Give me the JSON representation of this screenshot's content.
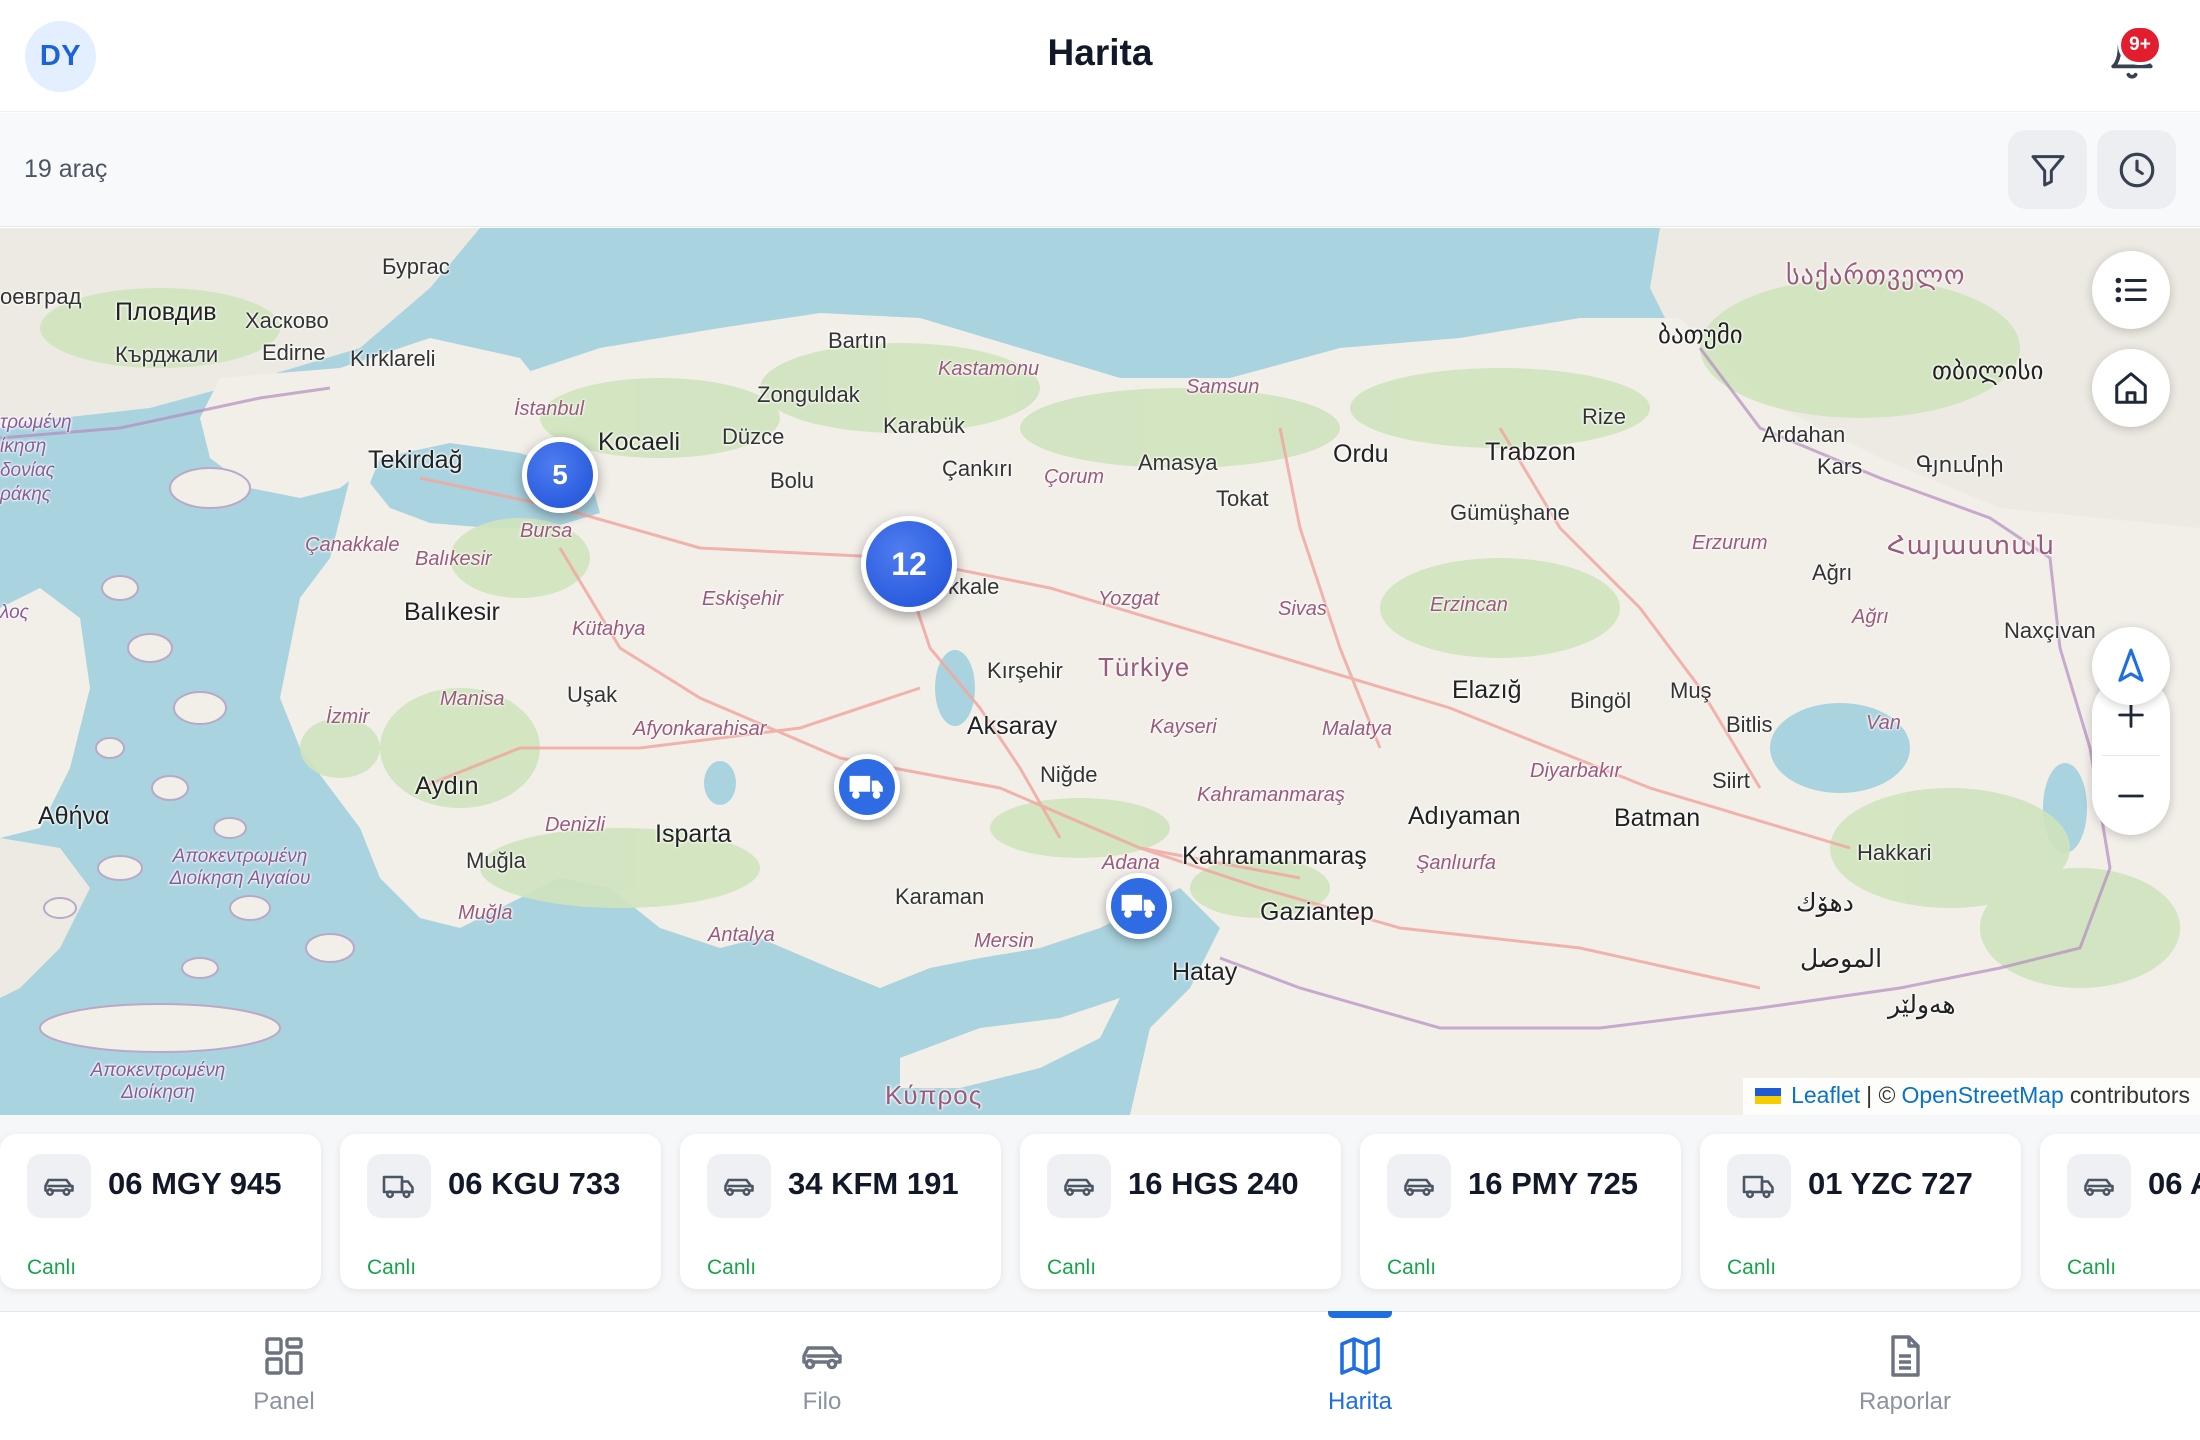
{
  "header": {
    "avatar_initials": "DY",
    "title": "Harita",
    "notification_badge": "9+",
    "notification_icon": "bell-icon"
  },
  "subbar": {
    "vehicle_count": "19 araç",
    "filter_icon": "filter-icon",
    "history_icon": "clock-icon"
  },
  "map": {
    "place_labels": {
      "bulgaria_plovdiv": "Пловдив",
      "bulgaria_haskovo": "Хасково",
      "bulgaria_kardzhali": "Кърджали",
      "bulgaria_burgas": "Бургас",
      "beograd": "оевград",
      "edirne": "Edirne",
      "kirklareli": "Kırklareli",
      "istanbul": "İstanbul",
      "tekirdag": "Tekirdağ",
      "kocaeli": "Kocaeli",
      "bursa": "Bursa",
      "canakkale": "Çanakkale",
      "balikesir_prov": "Balıkesir",
      "balikesir": "Balıkesir",
      "bartin": "Bartın",
      "zonguldak": "Zonguldak",
      "karabuk": "Karabük",
      "duzce": "Düzce",
      "bolu": "Bolu",
      "kastamonu": "Kastamonu",
      "cankiri": "Çankırı",
      "samsun": "Samsun",
      "amasya": "Amasya",
      "corum": "Çorum",
      "tokat": "Tokat",
      "ordu": "Ordu",
      "trabzon": "Trabzon",
      "rize": "Rize",
      "gumushane": "Gümüşhane",
      "batumi": "ბათუმი",
      "sakartvelo": "საქართველო",
      "tbilisi": "თბილისი",
      "ardahan": "Ardahan",
      "kars": "Kars",
      "gyumri": "Գյումրի",
      "hayastan": "Հայաստան",
      "erzurum": "Erzurum",
      "agri_city": "Ağrı",
      "agri_prov": "Ağrı",
      "nakhchivan": "Naxçıvan",
      "eskisehir": "Eskişehir",
      "kirikkale": "kkale",
      "yozgat": "Yozgat",
      "sivas": "Sivas",
      "erzincan": "Erzincan",
      "kutahya": "Kütahya",
      "manisa": "Manisa",
      "usak": "Uşak",
      "izmir": "İzmir",
      "afyon": "Afyonkarahisar",
      "kirsehir": "Kırşehir",
      "turkiye": "Türkiye",
      "aksaray": "Aksaray",
      "kayseri": "Kayseri",
      "malatya": "Malatya",
      "elazig": "Elazığ",
      "bingol": "Bingöl",
      "mus": "Muş",
      "bitlis": "Bitlis",
      "van": "Van",
      "aydin": "Aydın",
      "athens": "Αθήνα",
      "denizli": "Denizli",
      "isparta": "Isparta",
      "nigde": "Niğde",
      "kahramanmaras_prov": "Kahramanmaraş",
      "kahramanmaras": "Kahramanmaraş",
      "adiyaman": "Adıyaman",
      "diyarbakir": "Diyarbakır",
      "batman": "Batman",
      "siirt": "Siirt",
      "sanliurfa": "Şanlıurfa",
      "hakkari": "Hakkari",
      "mugla_city": "Muğla",
      "mugla_prov": "Muğla",
      "karaman": "Karaman",
      "adana": "Adana",
      "antalya": "Antalya",
      "mersin": "Mersin",
      "gaziantep": "Gaziantep",
      "hatay": "Hatay",
      "kibris": "Κύπρος",
      "mosul": "الموصل",
      "duhok": "دهۆك",
      "erbil": "هەولێر",
      "greek_region_1": "Αποκεντρωμένη Διοίκηση Αιγαίου",
      "greek_region_2": "Αποκεντρωμένη Διοίκηση",
      "greek_left_1": "τρωμένη",
      "greek_left_2": "ίκηση",
      "greek_left_3": "δονίας",
      "greek_left_4": "ράκης",
      "greek_left_5": "λος"
    },
    "clusters": [
      {
        "name": "istanbul-cluster",
        "count": "5"
      },
      {
        "name": "ankara-cluster",
        "count": "12"
      }
    ],
    "vehicle_markers": [
      "konya-vehicle-marker",
      "adana-vehicle-marker"
    ],
    "controls": {
      "list_icon": "list-icon",
      "home_icon": "home-icon",
      "zoom_in_icon": "plus-icon",
      "zoom_out_icon": "minus-icon",
      "locate_icon": "navigation-arrow-icon"
    },
    "attribution": {
      "leaflet": "Leaflet",
      "separator": "| ©",
      "osm": "OpenStreetMap",
      "contributors": "contributors"
    }
  },
  "vehicles": [
    {
      "plate": "06 MGY 945",
      "status": "Canlı",
      "type": "car-icon"
    },
    {
      "plate": "06 KGU 733",
      "status": "Canlı",
      "type": "truck-icon"
    },
    {
      "plate": "34 KFM 191",
      "status": "Canlı",
      "type": "car-icon"
    },
    {
      "plate": "16 HGS 240",
      "status": "Canlı",
      "type": "car-icon"
    },
    {
      "plate": "16 PMY 725",
      "status": "Canlı",
      "type": "car-icon"
    },
    {
      "plate": "01 YZC 727",
      "status": "Canlı",
      "type": "truck-icon"
    },
    {
      "plate": "06 A",
      "status": "Canlı",
      "type": "car-icon"
    }
  ],
  "nav": [
    {
      "label": "Panel",
      "icon": "grid-icon",
      "active": false
    },
    {
      "label": "Filo",
      "icon": "car-icon",
      "active": false
    },
    {
      "label": "Harita",
      "icon": "map-icon",
      "active": true
    },
    {
      "label": "Raporlar",
      "icon": "document-icon",
      "active": false
    }
  ],
  "colors": {
    "accent": "#1f6fe0",
    "status_live": "#16a34a",
    "badge": "#e11d2e",
    "sea": "#a9d3df",
    "land": "#f2efe9"
  }
}
